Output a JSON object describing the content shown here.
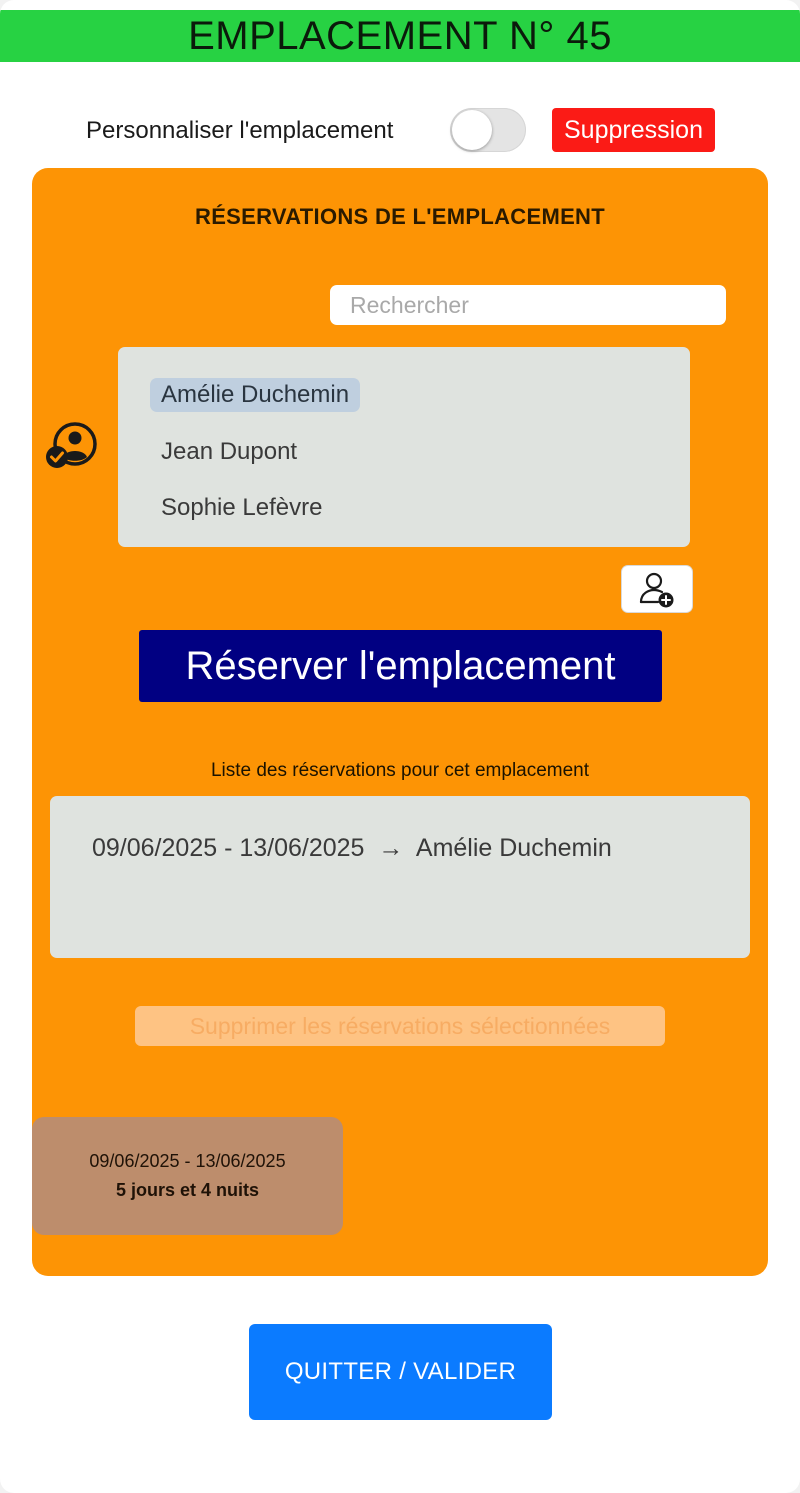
{
  "header": {
    "title": "EMPLACEMENT N° 45",
    "bar_color": "#27d243"
  },
  "options": {
    "customize_label": "Personnaliser l'emplacement",
    "customize_toggle_on": false,
    "delete_label": "Suppression"
  },
  "reservations_panel": {
    "title": "RÉSERVATIONS DE L'EMPLACEMENT",
    "accent_color": "#fd9405",
    "search": {
      "placeholder": "Rechercher",
      "value": ""
    },
    "people_icon": "person-check-icon",
    "people": [
      {
        "name": "Amélie Duchemin",
        "selected": true
      },
      {
        "name": "Jean Dupont",
        "selected": false
      },
      {
        "name": "Sophie Lefèvre",
        "selected": false
      }
    ],
    "add_person_icon": "person-add-icon",
    "reserve_button": "Réserver l'emplacement",
    "list_caption": "Liste des réservations pour cet emplacement",
    "reservations": [
      {
        "dates": "09/06/2025 - 13/06/2025",
        "arrow": "→",
        "guest": "Amélie Duchemin"
      }
    ],
    "delete_selected_button": "Supprimer les réservations sélectionnées",
    "summary": {
      "dates": "09/06/2025 - 13/06/2025",
      "duration": "5 jours et 4 nuits"
    }
  },
  "footer": {
    "quit_button": "QUITTER / VALIDER"
  }
}
